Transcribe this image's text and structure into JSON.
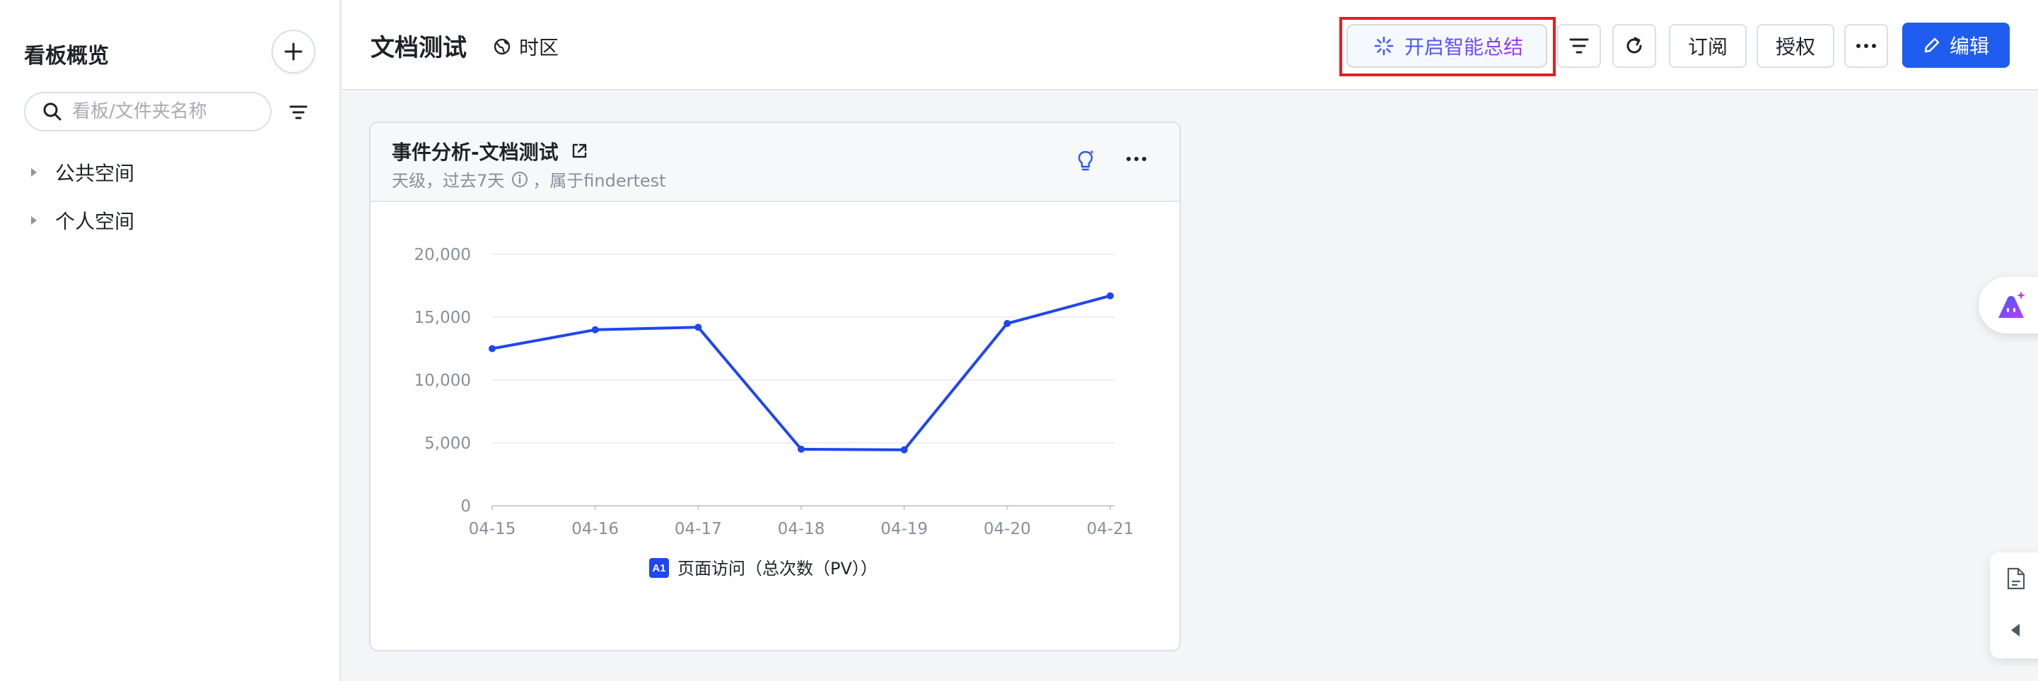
{
  "sidebar": {
    "title": "看板概览",
    "search": {
      "placeholder": "看板/文件夹名称",
      "value": ""
    },
    "tree": [
      {
        "label": "公共空间"
      },
      {
        "label": "个人空间"
      }
    ]
  },
  "header": {
    "title": "文档测试",
    "timezone_label": "时区",
    "ai_summary_label": "开启智能总结",
    "subscribe_label": "订阅",
    "authorize_label": "授权",
    "edit_label": "编辑"
  },
  "card": {
    "title": "事件分析-文档测试",
    "subtitle_a": "天级，过去7天",
    "subtitle_b": "，属于findertest"
  },
  "chart_data": {
    "type": "line",
    "categories": [
      "04-15",
      "04-16",
      "04-17",
      "04-18",
      "04-19",
      "04-20",
      "04-21"
    ],
    "series": [
      {
        "name": "页面访问（总次数（PV））",
        "badge": "A1",
        "values": [
          12500,
          14000,
          14200,
          4500,
          4450,
          14500,
          16700
        ]
      }
    ],
    "y_ticks": [
      "20,000",
      "15,000",
      "10,000",
      "5,000",
      "0"
    ],
    "ylim": [
      0,
      20000
    ],
    "grid": true,
    "legend_position": "bottom",
    "colors": {
      "line": "#1f46f0"
    }
  },
  "colors": {
    "accent": "#1f5cf0",
    "highlight": "#e02020",
    "ai_gradient_start": "#3a5cff",
    "ai_gradient_end": "#9b3cf0"
  }
}
